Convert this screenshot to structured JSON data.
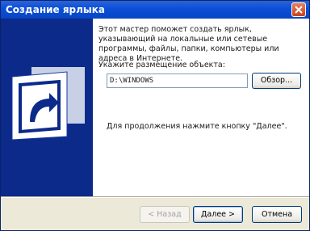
{
  "window": {
    "title": "Создание ярлыка"
  },
  "wizard": {
    "description": "Этот мастер поможет создать ярлык, указывающий на локальные или сетевые программы, файлы, папки, компьютеры или адреса в Интернете.",
    "location_label": "Укажите размещение объекта:",
    "location_value": "D:\\WINDOWS",
    "browse_label": "Обзор...",
    "continue_hint": "Для продолжения нажмите кнопку \"Далее\"."
  },
  "buttons": {
    "back_label": "< Назад",
    "next_label": "Далее >",
    "cancel_label": "Отмена"
  },
  "colors": {
    "side_panel": "#0c2a8a",
    "titlebar": "#0a4fd8"
  },
  "icons": {
    "title_close": "close-icon",
    "wizard_graphic": "shortcut-arrow-icon"
  }
}
